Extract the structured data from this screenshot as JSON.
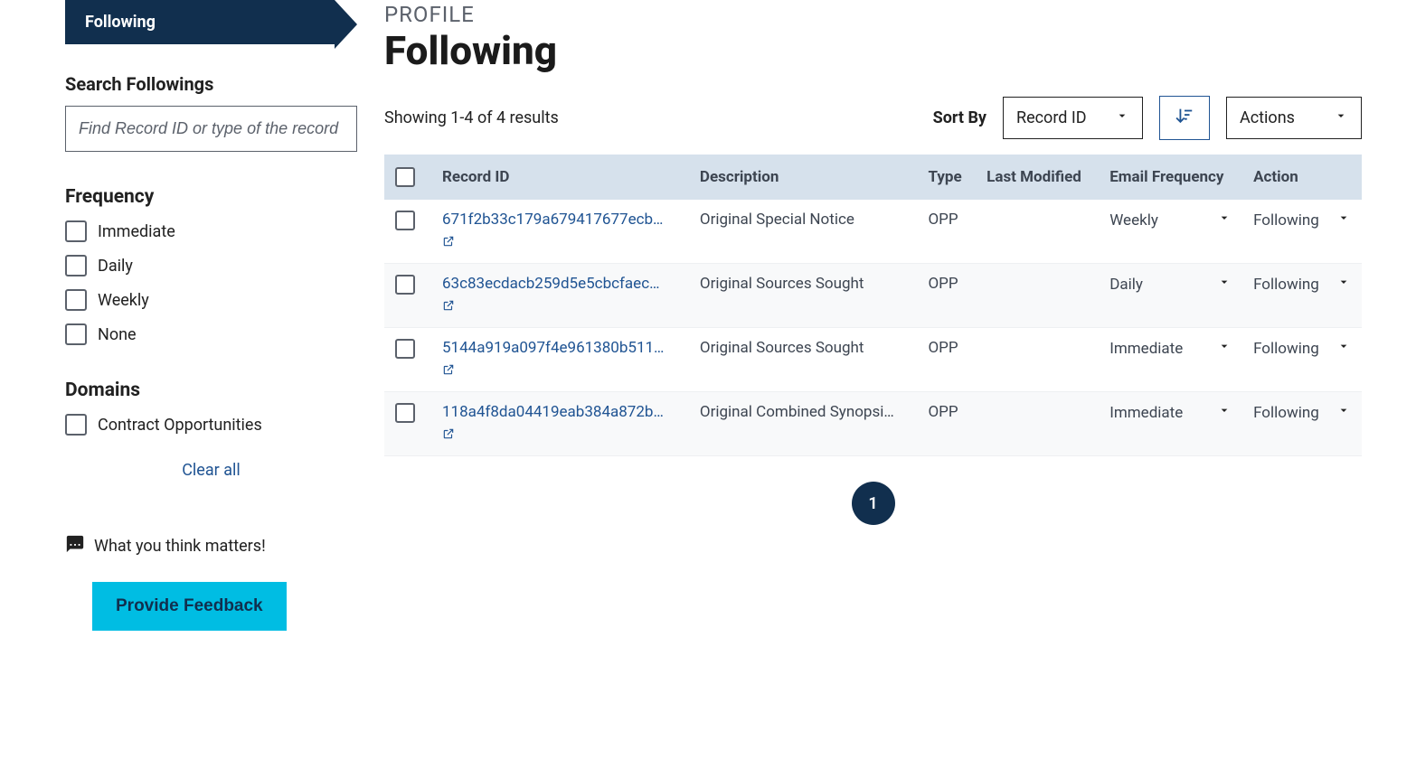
{
  "sidebar": {
    "nav_label": "Following",
    "search_label": "Search Followings",
    "search_placeholder": "Find Record ID or type of the record",
    "frequency_heading": "Frequency",
    "frequency_options": [
      "Immediate",
      "Daily",
      "Weekly",
      "None"
    ],
    "domains_heading": "Domains",
    "domains_options": [
      "Contract Opportunities"
    ],
    "clear_all": "Clear all",
    "feedback_line": "What you think matters!",
    "feedback_button": "Provide Feedback"
  },
  "header": {
    "breadcrumb": "PROFILE",
    "title": "Following"
  },
  "toolbar": {
    "showing": "Showing 1-4 of 4 results",
    "sortby_label": "Sort By",
    "sort_field": "Record ID",
    "actions_label": "Actions"
  },
  "table": {
    "headers": {
      "record_id": "Record ID",
      "description": "Description",
      "type": "Type",
      "last_modified": "Last Modified",
      "email_frequency": "Email Frequency",
      "action": "Action"
    },
    "rows": [
      {
        "record_id": "671f2b33c179a679417677ecb…",
        "description": "Original Special Notice",
        "type": "OPP",
        "last_modified": "",
        "email_frequency": "Weekly",
        "action": "Following"
      },
      {
        "record_id": "63c83ecdacb259d5e5cbcfaec…",
        "description": "Original Sources Sought",
        "type": "OPP",
        "last_modified": "",
        "email_frequency": "Daily",
        "action": "Following"
      },
      {
        "record_id": "5144a919a097f4e961380b511…",
        "description": "Original Sources Sought",
        "type": "OPP",
        "last_modified": "",
        "email_frequency": "Immediate",
        "action": "Following"
      },
      {
        "record_id": "118a4f8da04419eab384a872b…",
        "description": "Original Combined Synopsi…",
        "type": "OPP",
        "last_modified": "",
        "email_frequency": "Immediate",
        "action": "Following"
      }
    ]
  },
  "pager": {
    "current": "1"
  }
}
